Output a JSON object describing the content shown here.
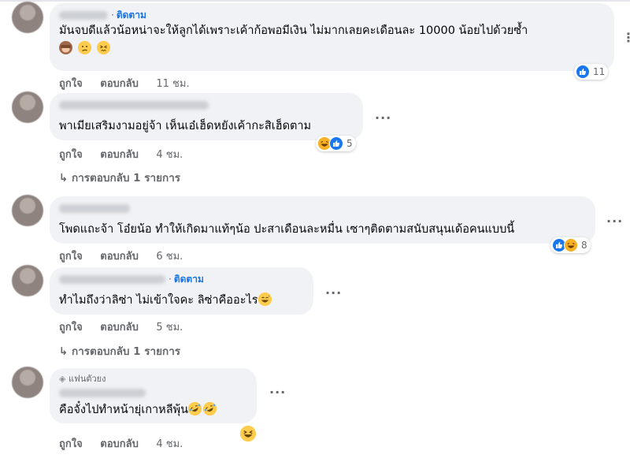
{
  "colors": {
    "blue": "#1b74e4",
    "like": "#1877f2",
    "bubble": "#f0f2f5",
    "muted": "#65676b"
  },
  "comments": [
    {
      "follow": "ติดตาม",
      "text": "มันจบดีแล้วน้อหน่าจะให้ลูกได้เพราะเค้าก้อพอมีเงิน ไม่มากเลยคะเดือนละ 10000 น้อยไปด้วยซ้ำ",
      "emojis": [
        "see-no-evil-monkey",
        "confused-face",
        "confounded-face"
      ],
      "actions": {
        "like": "ถูกใจ",
        "reply": "ตอบกลับ",
        "time": "11 ชม."
      },
      "reactions": {
        "icons": [
          "like"
        ],
        "count": "11"
      }
    },
    {
      "text": "พาเมียเสริมงามอยู่จ้า เห็นเอ๋เฮ็ดหยังเค้ากะสิเฮ็ดตาม",
      "actions": {
        "like": "ถูกใจ",
        "reply": "ตอบกลับ",
        "time": "4 ชม."
      },
      "reactions": {
        "icons": [
          "haha",
          "like"
        ],
        "count": "5"
      },
      "replies_label": "การตอบกลับ 1 รายการ"
    },
    {
      "text": "โพดแถะจ้า โอ๋ยน้อ ทำให้เกิดมาแท้ๆน้อ ปะสาเดือนละหมื่น เซาๆติดตามสนับสนุนเด้อคนแบบนี้",
      "actions": {
        "like": "ถูกใจ",
        "reply": "ตอบกลับ",
        "time": "6 ชม."
      },
      "reactions": {
        "icons": [
          "like",
          "haha"
        ],
        "count": "8"
      }
    },
    {
      "follow": "ติดตาม",
      "text": "ทำไมถึงว่าลิซ่า ไม่เข้าใจคะ ลิซ่าคืออะไร",
      "emojis": [
        "grinning-sweat-face"
      ],
      "actions": {
        "like": "ถูกใจ",
        "reply": "ตอบกลับ",
        "time": "5 ชม."
      },
      "replies_label": "การตอบกลับ 1 รายการ"
    },
    {
      "badge": "แฟนตัวยง",
      "text": "คือจั๋งไปทำหน้ายุ่เกาหลีพุ้น",
      "emojis": [
        "rolling-laughing-face",
        "rolling-laughing-face",
        "grinning-squinting-face"
      ],
      "actions": {
        "like": "ถูกใจ",
        "reply": "ตอบกลับ",
        "time": "4 ชม."
      }
    }
  ]
}
